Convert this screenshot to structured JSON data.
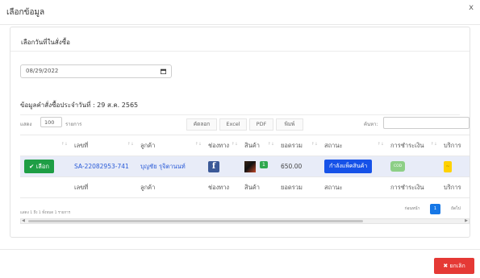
{
  "modal": {
    "title": "เลือกข้อมูล",
    "close_glyph": "x"
  },
  "card": {
    "title": "เลือกวันที่ในสั่งซื้อ",
    "date_value": "08/29/2022",
    "data_title": "ข้อมูลคำสั่งซื้อประจำวันที่ : 29 ส.ค. 2565"
  },
  "table_controls": {
    "length_prefix": "แสดง",
    "length_value": "100",
    "length_suffix": "รายการ",
    "buttons": [
      "คัดลอก",
      "Excel",
      "PDF",
      "พิมพ์"
    ],
    "search_label": "ค้นหา:"
  },
  "table": {
    "columns": [
      "",
      "เลขที่",
      "ลูกค้า",
      "ช่องทาง",
      "สินค้า",
      "ยอดรวม",
      "สถานะ",
      "การชำระเงิน",
      "บริการ"
    ],
    "row": {
      "select_label": "เลือก",
      "order_no": "SA-22082953-741",
      "customer": "บุญชัย รุจิตานนท์",
      "qty": "1",
      "total": "650.00",
      "status": "กำลังแพ็คสินค้า",
      "payment": "COD"
    }
  },
  "pagination": {
    "info": "แสดง 1 ถึง 1 ทั้งหมด 1 รายการ",
    "prev": "ก่อนหน้า",
    "page": "1",
    "next": "ถัดไป"
  },
  "footer": {
    "cancel_label": "ยกเลิก"
  },
  "icons": {
    "channel": "facebook-icon",
    "checkmark": "✔",
    "cancel": "✖"
  },
  "colors": {
    "select_button": "#1e9e45",
    "status_badge": "#1652e8",
    "cancel_button": "#e53935",
    "pagination_active": "#1677e6"
  }
}
